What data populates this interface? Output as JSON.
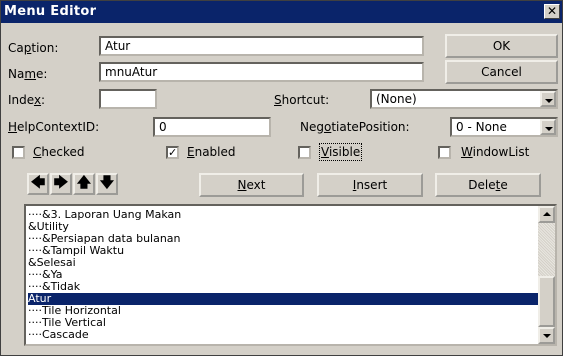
{
  "window": {
    "title": "Menu Editor",
    "close_glyph": "✕"
  },
  "caption": {
    "label_pre": "Ca",
    "label_u": "p",
    "label_post": "tion:",
    "value": "Atur"
  },
  "name": {
    "label_pre": "Na",
    "label_u": "m",
    "label_post": "e:",
    "value": "mnuAtur"
  },
  "index": {
    "label_pre": "Inde",
    "label_u": "x",
    "label_post": ":",
    "value": ""
  },
  "shortcut": {
    "label_u": "S",
    "label_post": "hortcut:",
    "value": "(None)"
  },
  "helpcontext": {
    "label_u": "H",
    "label_post": "elpContextID:",
    "value": "0"
  },
  "negotiate": {
    "label_pre": "Neg",
    "label_u": "o",
    "label_post": "tiatePosition:",
    "value": "0 - None"
  },
  "buttons": {
    "ok": "OK",
    "cancel": "Cancel",
    "next_u": "N",
    "next_post": "ext",
    "insert_u": "I",
    "insert_post": "nsert",
    "delete_pre": "Dele",
    "delete_u": "t",
    "delete_post": "e"
  },
  "checks": {
    "checked": {
      "label_u": "C",
      "label_post": "hecked",
      "checked": false
    },
    "enabled": {
      "label_u": "E",
      "label_post": "nabled",
      "checked": true
    },
    "visible": {
      "label_u": "V",
      "label_post": "isible",
      "checked": false
    },
    "windowlist": {
      "label_u": "W",
      "label_post": "indowList",
      "checked": false
    }
  },
  "arrows": {
    "left": "🡄",
    "right": "🡆",
    "up": "🡅",
    "down": "🡇"
  },
  "menu_list": {
    "items": [
      "····&3. Laporan Uang Makan",
      "&Utility",
      "····&Persiapan data bulanan",
      "····&Tampil Waktu",
      "&Selesai",
      "····&Ya",
      "····&Tidak",
      "Atur",
      "····Tile Horizontal",
      "····Tile Vertical",
      "····Cascade"
    ],
    "selected_index": 7
  },
  "colors": {
    "title_bar": "#0a246a",
    "face": "#d4d0c8",
    "selection": "#0a246a"
  }
}
